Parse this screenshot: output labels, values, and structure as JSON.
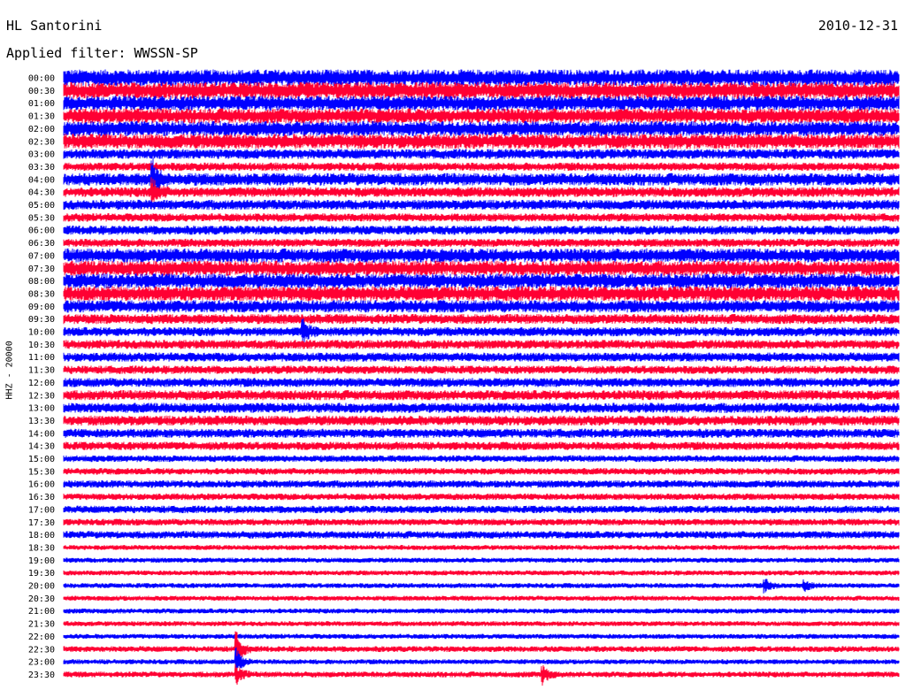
{
  "header": {
    "station": "HL Santorini",
    "date": "2010-12-31",
    "filter": "Applied filter: WWSSN-SP"
  },
  "chart_data": {
    "type": "line",
    "ylabel": "HHZ - 20000",
    "xlabel": "",
    "row_labels": [
      "00:00",
      "00:30",
      "01:00",
      "01:30",
      "02:00",
      "02:30",
      "03:00",
      "03:30",
      "04:00",
      "04:30",
      "05:00",
      "05:30",
      "06:00",
      "06:30",
      "07:00",
      "07:30",
      "08:00",
      "08:30",
      "09:00",
      "09:30",
      "10:00",
      "10:30",
      "11:00",
      "11:30",
      "12:00",
      "12:30",
      "13:00",
      "13:30",
      "14:00",
      "14:30",
      "15:00",
      "15:30",
      "16:00",
      "16:30",
      "17:00",
      "17:30",
      "18:00",
      "18:30",
      "19:00",
      "19:30",
      "20:00",
      "20:30",
      "21:00",
      "21:30",
      "22:00",
      "22:30",
      "23:00",
      "23:30"
    ],
    "trace_colors": [
      "#0000ff",
      "#ff0033"
    ],
    "relative_amplitude": [
      1.0,
      1.0,
      0.9,
      0.9,
      0.9,
      0.9,
      0.6,
      0.5,
      0.75,
      0.6,
      0.6,
      0.5,
      0.55,
      0.5,
      0.85,
      0.9,
      0.9,
      0.9,
      0.75,
      0.6,
      0.55,
      0.55,
      0.55,
      0.5,
      0.55,
      0.6,
      0.6,
      0.6,
      0.55,
      0.5,
      0.4,
      0.4,
      0.45,
      0.4,
      0.45,
      0.4,
      0.45,
      0.3,
      0.3,
      0.3,
      0.3,
      0.3,
      0.3,
      0.3,
      0.3,
      0.35,
      0.3,
      0.35
    ],
    "events": [
      {
        "row": 45,
        "minute": 6.2,
        "amplitude": 3.5
      },
      {
        "row": 46,
        "minute": 6.2,
        "amplitude": 3.0
      },
      {
        "row": 47,
        "minute": 6.2,
        "amplitude": 2.0
      },
      {
        "row": 47,
        "minute": 17.2,
        "amplitude": 1.8
      },
      {
        "row": 40,
        "minute": 25.2,
        "amplitude": 1.4
      },
      {
        "row": 40,
        "minute": 26.6,
        "amplitude": 1.3
      },
      {
        "row": 20,
        "minute": 8.6,
        "amplitude": 1.3
      },
      {
        "row": 9,
        "minute": 3.2,
        "amplitude": 1.5
      },
      {
        "row": 8,
        "minute": 3.2,
        "amplitude": 1.6
      }
    ]
  }
}
